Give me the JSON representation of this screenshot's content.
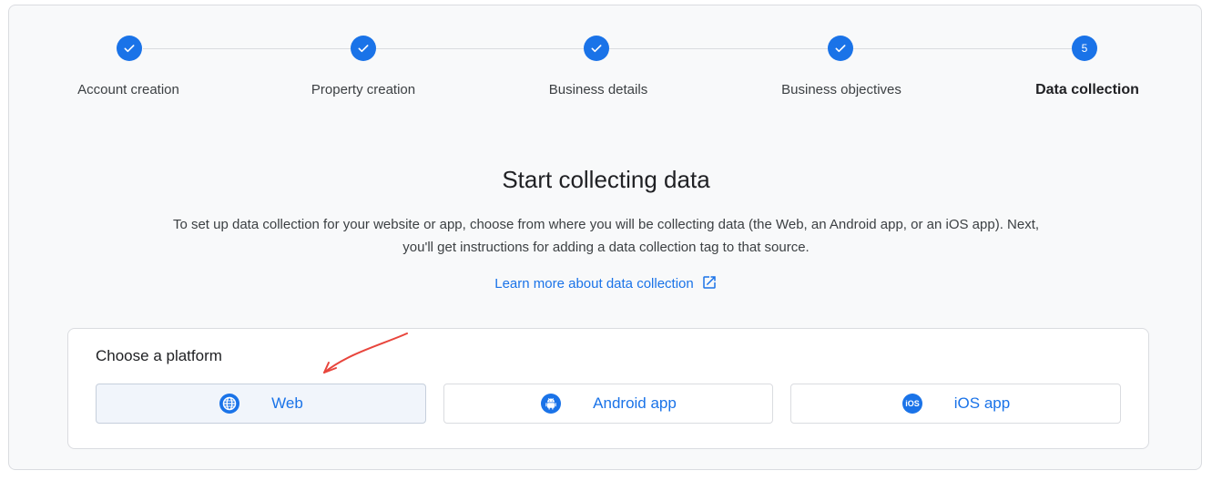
{
  "stepper": {
    "steps": [
      {
        "label": "Account creation",
        "marker": ""
      },
      {
        "label": "Property creation",
        "marker": ""
      },
      {
        "label": "Business details",
        "marker": ""
      },
      {
        "label": "Business objectives",
        "marker": ""
      },
      {
        "label": "Data collection",
        "marker": "5"
      }
    ],
    "completed_count": 4,
    "active_index": 4
  },
  "main": {
    "headline": "Start collecting data",
    "description": "To set up data collection for your website or app, choose from where you will be collecting data (the Web, an Android app, or an iOS app). Next, you'll get instructions for adding a data collection tag to that source.",
    "learn_more": "Learn more about data collection"
  },
  "platform": {
    "title": "Choose a platform",
    "options": [
      {
        "label": "Web",
        "icon": "globe-icon",
        "selected": true
      },
      {
        "label": "Android app",
        "icon": "android-icon",
        "selected": false
      },
      {
        "label": "iOS app",
        "icon": "ios-icon",
        "selected": false
      }
    ]
  },
  "colors": {
    "accent": "#1a73e8",
    "annotation_arrow": "#e8453c"
  }
}
